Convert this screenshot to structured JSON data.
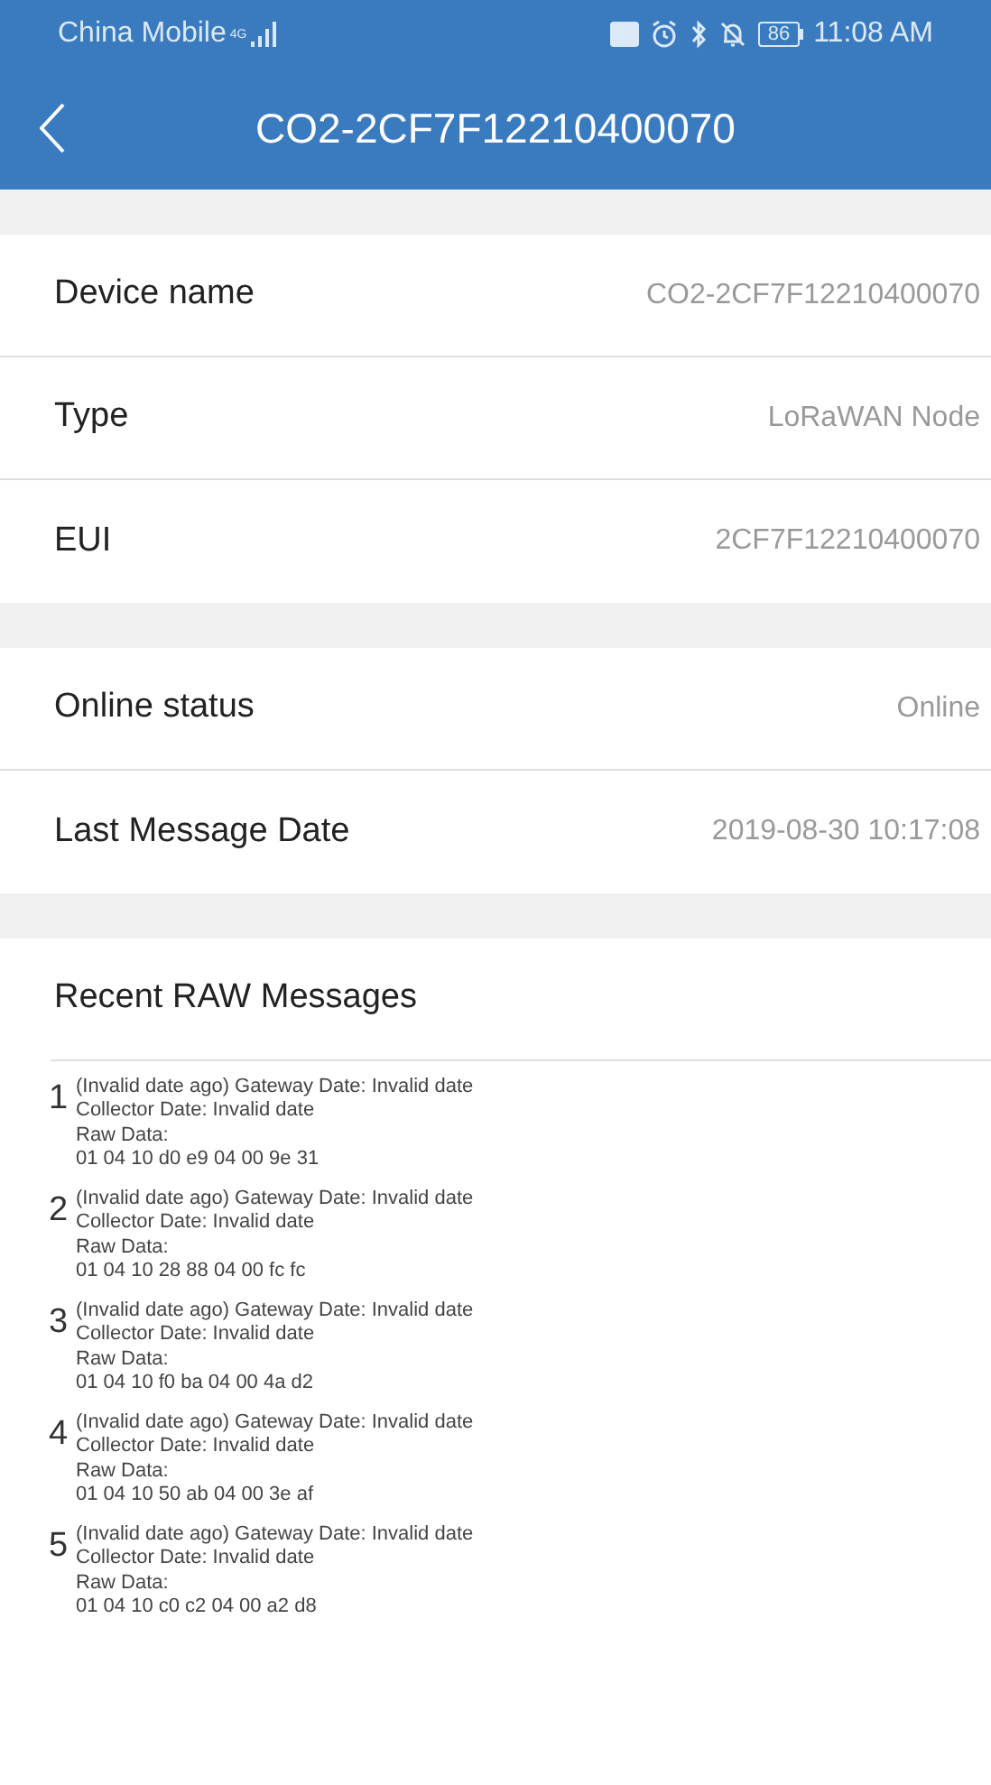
{
  "status_bar": {
    "carrier": "China Mobile",
    "network": "4G",
    "battery": "86",
    "time": "11:08 AM"
  },
  "header": {
    "title": "CO2-2CF7F12210400070"
  },
  "sections": [
    {
      "rows": [
        {
          "label": "Device name",
          "value": "CO2-2CF7F12210400070"
        },
        {
          "label": "Type",
          "value": "LoRaWAN Node"
        },
        {
          "label": "EUI",
          "value": "2CF7F12210400070"
        }
      ]
    },
    {
      "rows": [
        {
          "label": "Online status",
          "value": "Online"
        },
        {
          "label": "Last Message Date",
          "value": "2019-08-30 10:17:08"
        }
      ]
    }
  ],
  "messages": {
    "title": "Recent RAW Messages",
    "items": [
      {
        "number": "1",
        "line_1": "(Invalid date ago) Gateway Date: Invalid date",
        "line_2": "Collector Date: Invalid date",
        "line_3": "Raw Data:",
        "line_4": "01 04 10 d0 e9 04 00 9e 31"
      },
      {
        "number": "2",
        "line_1": "(Invalid date ago) Gateway Date: Invalid date",
        "line_2": "Collector Date: Invalid date",
        "line_3": "Raw Data:",
        "line_4": "01 04 10 28 88 04 00 fc fc"
      },
      {
        "number": "3",
        "line_1": "(Invalid date ago) Gateway Date: Invalid date",
        "line_2": "Collector Date: Invalid date",
        "line_3": "Raw Data:",
        "line_4": "01 04 10 f0 ba 04 00 4a d2"
      },
      {
        "number": "4",
        "line_1": "(Invalid date ago) Gateway Date: Invalid date",
        "line_2": "Collector Date: Invalid date",
        "line_3": "Raw Data:",
        "line_4": "01 04 10 50 ab 04 00 3e af"
      },
      {
        "number": "5",
        "line_1": "(Invalid date ago) Gateway Date: Invalid date",
        "line_2": "Collector Date: Invalid date",
        "line_3": "Raw Data:",
        "line_4": "01 04 10 c0 c2 04 00 a2 d8"
      }
    ]
  }
}
